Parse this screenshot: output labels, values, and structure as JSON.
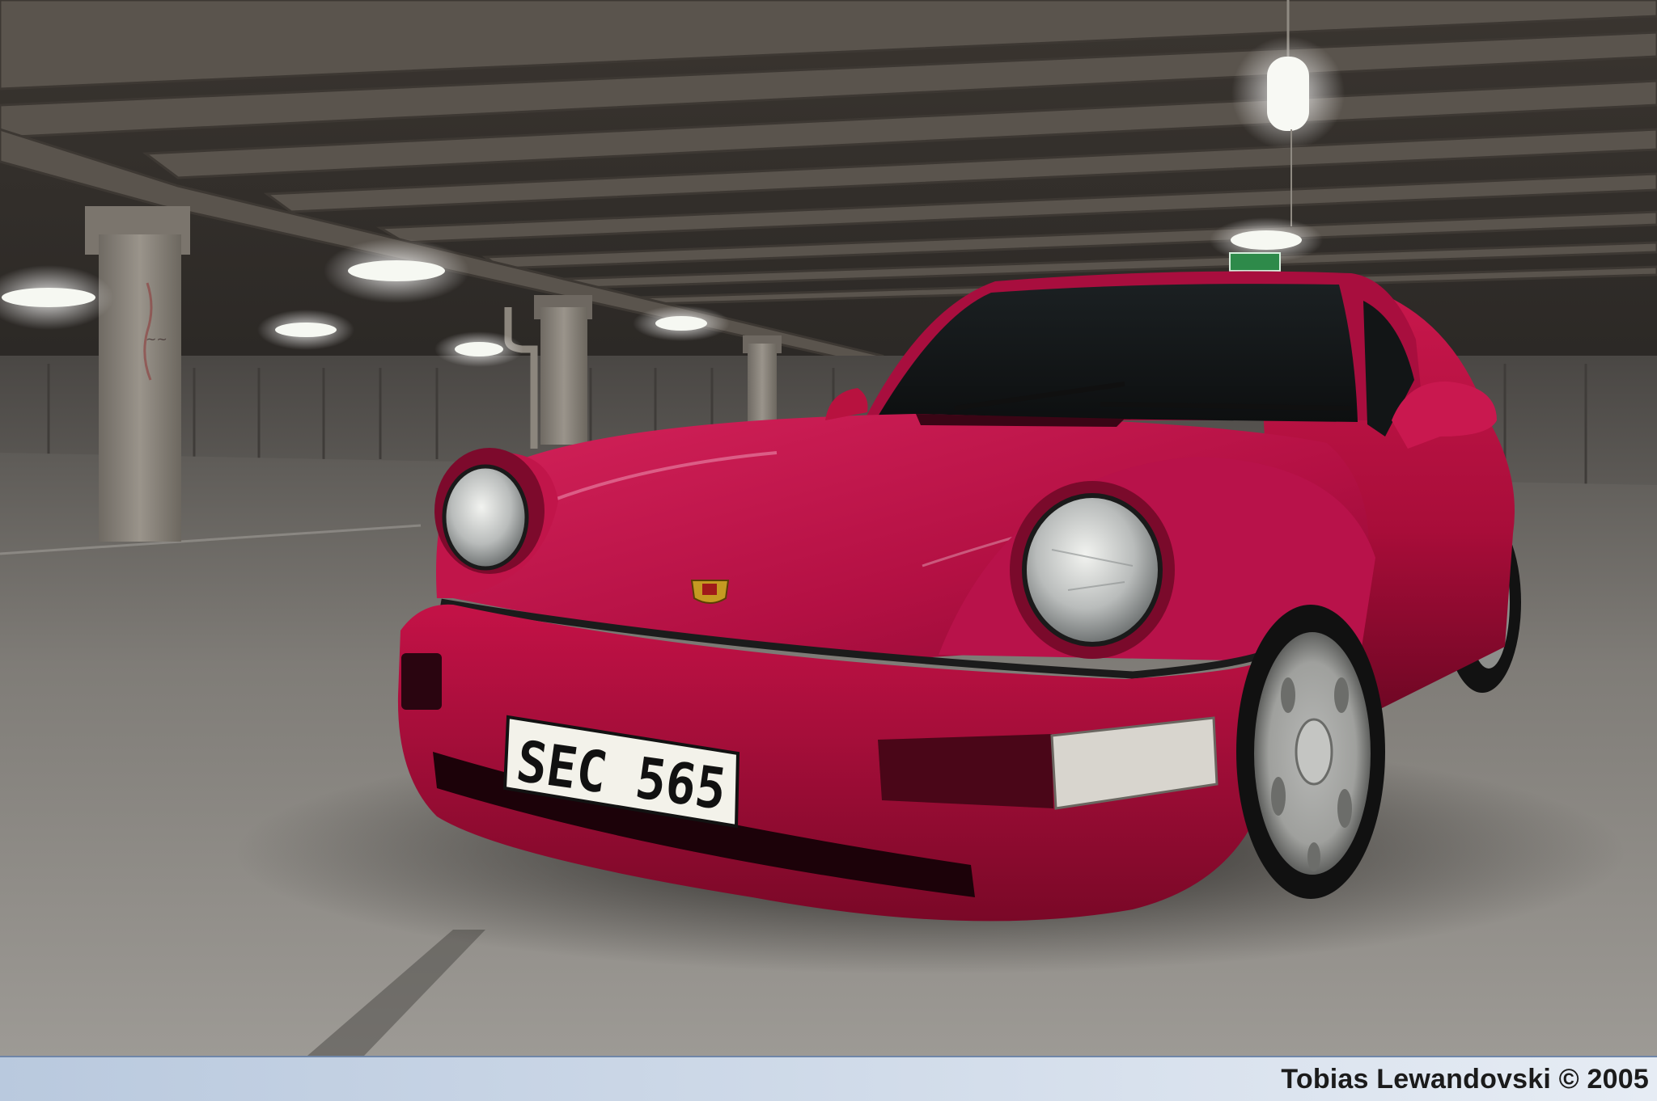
{
  "photo": {
    "subject": "red-porsche-911-coupe",
    "setting": "underground-parking-garage"
  },
  "license_plate": {
    "text": "SEC 565"
  },
  "caption": {
    "credit": "Tobias Lewandovski © 2005"
  },
  "colors": {
    "car_body": "#b0103e",
    "car_shadow": "#5a0620",
    "floor": "#8f8c87",
    "ceiling": "#4e4943",
    "pillar": "#8a847c",
    "wall": "#5c5955",
    "caption_bar_top": "#b9c9de",
    "caption_bar_bottom": "#e6ecf4",
    "light": "#f3f6ee"
  }
}
